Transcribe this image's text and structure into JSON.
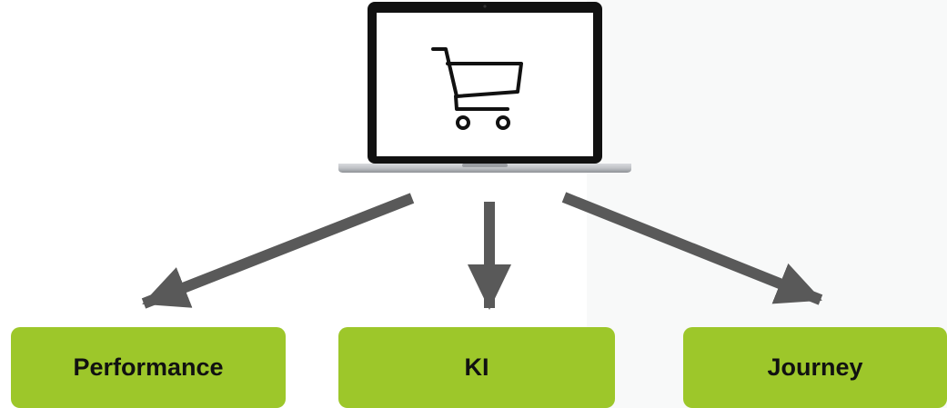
{
  "colors": {
    "node_fill": "#9dc72a",
    "arrow": "#595959",
    "screen_bezel": "#111111",
    "laptop_body": "#bfc2c6"
  },
  "icons": {
    "center": "shopping-cart-icon",
    "device": "laptop-icon"
  },
  "nodes": [
    {
      "label": "Performance"
    },
    {
      "label": "KI"
    },
    {
      "label": "Journey"
    }
  ]
}
